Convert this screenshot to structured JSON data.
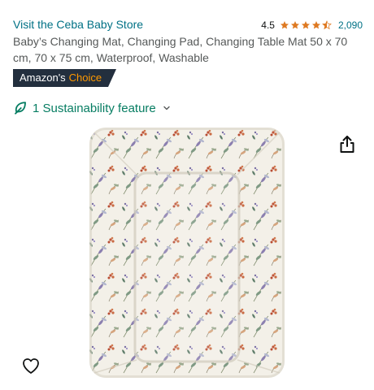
{
  "store": {
    "link_text": "Visit the Ceba Baby Store"
  },
  "rating": {
    "value": "4.5",
    "stars": 4.5,
    "count": "2,090",
    "star_color": "#de7921"
  },
  "product": {
    "title": "Baby’s Changing Mat, Changing Pad, Changing Table Mat 50 x 70 cm, 70 x 75 cm, Waterproof, Washable"
  },
  "badge": {
    "prefix": "Amazon's",
    "accent": "Choice",
    "bg_color": "#232f3e",
    "accent_color": "#ff9900"
  },
  "sustainability": {
    "label": "1 Sustainability feature",
    "color": "#067d62"
  },
  "icons": {
    "share": "share-icon",
    "wishlist": "heart-icon",
    "leaf": "leaf-icon",
    "chevron": "chevron-down-icon"
  },
  "colors": {
    "link": "#007185",
    "text_secondary": "#565959"
  }
}
